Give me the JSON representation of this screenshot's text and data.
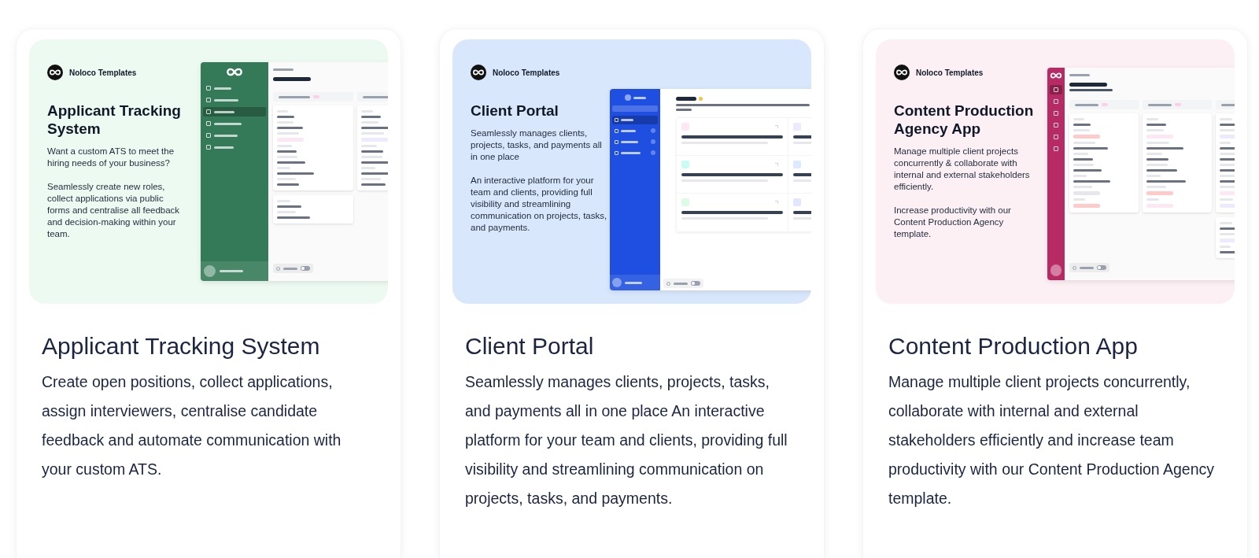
{
  "cards": [
    {
      "title": "Applicant Tracking System",
      "description": "Create open positions, collect applications, assign interviewers, centralise candidate feedback and automate communication with your custom ATS.",
      "preview": {
        "brand": "Noloco Templates",
        "heading": "Applicant Tracking System",
        "paragraphs": [
          "Want a custom ATS to meet the hiring needs of your business?",
          "Seamlessly create new roles, collect applications via public forms and centralise all feedback and decision-making within your team."
        ],
        "app": {
          "kind": "board"
        }
      }
    },
    {
      "title": "Client Portal",
      "description": "Seamlessly manages clients, projects, tasks, and payments all in one place An interactive platform for your team and clients, providing full visibility and streamlining communication on projects, tasks, and payments.",
      "preview": {
        "brand": "Noloco Templates",
        "heading": "Client Portal",
        "paragraphs": [
          "Seamlessly manages clients, projects, tasks, and payments all in one place",
          "An interactive platform for your team and clients, providing full visibility and streamlining communication on projects, tasks, and payments."
        ],
        "app": {
          "kind": "portal"
        }
      }
    },
    {
      "title": "Content Production App",
      "description": "Manage multiple client projects concurrently, collaborate with internal and external stakeholders efficiently and increase team productivity with our Content Production Agency template.",
      "preview": {
        "brand": "Noloco Templates",
        "heading": "Content Production Agency App",
        "paragraphs": [
          "Manage multiple client projects concurrently & collaborate with internal and external stakeholders efficiently.",
          "Increase  productivity with our Content Production Agency template."
        ],
        "app": {
          "kind": "pipeline"
        }
      }
    }
  ]
}
